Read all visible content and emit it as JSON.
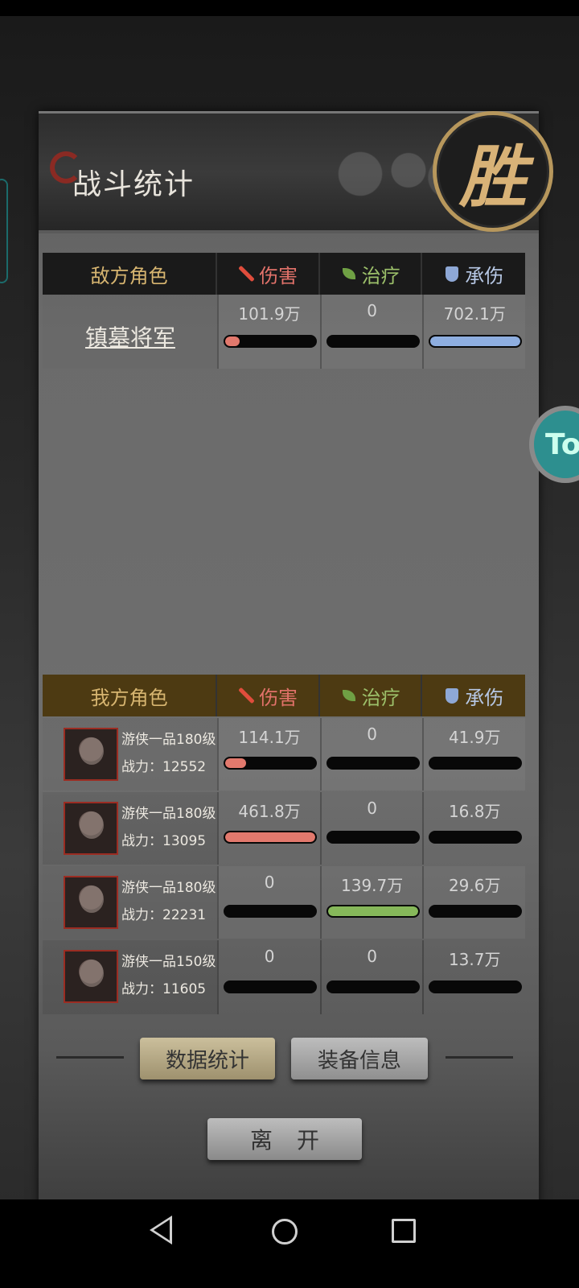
{
  "header": {
    "title": "战斗统计",
    "seal": "胜"
  },
  "float_button": {
    "label": "To"
  },
  "columns": {
    "damage": "伤害",
    "heal": "治疗",
    "tank": "承伤"
  },
  "enemy": {
    "header": "敌方角色",
    "rows": [
      {
        "name": "镇墓将军",
        "damage": "101.9万",
        "damage_frac": 0.16,
        "heal": "0",
        "heal_frac": 0,
        "tank": "702.1万",
        "tank_frac": 1.0
      }
    ]
  },
  "ally": {
    "header": "我方角色",
    "rows": [
      {
        "title": "游侠一品180级",
        "power": "战力：12552",
        "damage": "114.1万",
        "damage_frac": 0.23,
        "heal": "0",
        "heal_frac": 0,
        "tank": "41.9万",
        "tank_frac": 0
      },
      {
        "title": "游侠一品180级",
        "power": "战力：13095",
        "damage": "461.8万",
        "damage_frac": 1.0,
        "heal": "0",
        "heal_frac": 0,
        "tank": "16.8万",
        "tank_frac": 0
      },
      {
        "title": "游侠一品180级",
        "power": "战力：22231",
        "damage": "0",
        "damage_frac": 0,
        "heal": "139.7万",
        "heal_frac": 1.0,
        "tank": "29.6万",
        "tank_frac": 0
      },
      {
        "title": "游侠一品150级",
        "power": "战力：11605",
        "damage": "0",
        "damage_frac": 0,
        "heal": "0",
        "heal_frac": 0,
        "tank": "13.7万",
        "tank_frac": 0
      }
    ]
  },
  "tabs": {
    "stats": "数据统计",
    "equipment": "装备信息"
  },
  "leave_label": "离开",
  "colors": {
    "damage": "#e2796d",
    "heal": "#86b85a",
    "tank": "#8eaee0",
    "accent": "#d7b570"
  }
}
